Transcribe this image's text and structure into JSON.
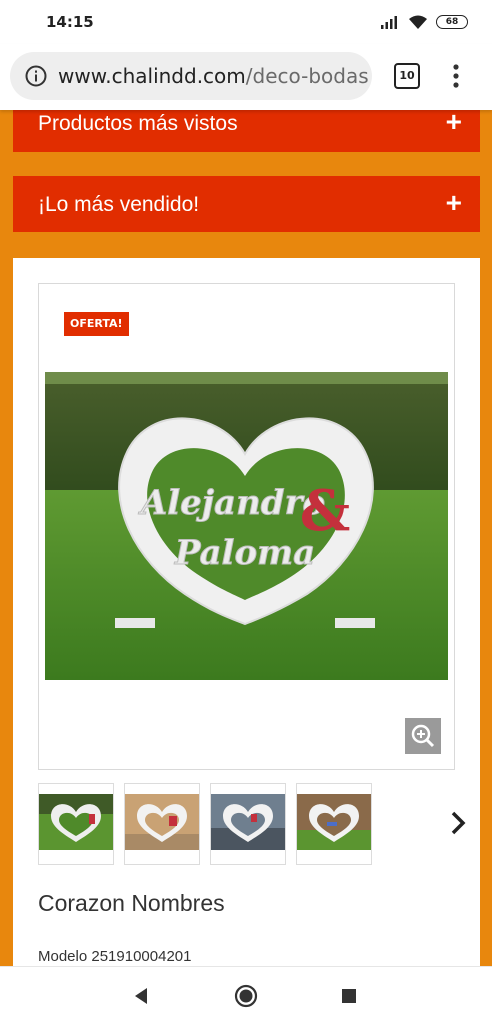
{
  "status_bar": {
    "time": "14:15",
    "battery_level": "68"
  },
  "browser": {
    "url_domain": "www.chalindd.com",
    "url_path": "/deco-bodas/",
    "tab_count": "10",
    "icons": [
      "info-icon",
      "more-vert-icon"
    ]
  },
  "accordions": [
    {
      "label": "Productos más vistos",
      "icon": "plus-icon"
    },
    {
      "label": "¡Lo más vendido!",
      "icon": "plus-icon"
    }
  ],
  "product": {
    "badge": "OFERTA!",
    "image_text": {
      "name1": "Alejandro",
      "ampersand": "&",
      "name2": "Paloma"
    },
    "thumbnail_count": 4,
    "name": "Corazon Nombres",
    "model": "Modelo 251910004201"
  },
  "colors": {
    "page_orange": "#e8870d",
    "bar_red": "#e12d00",
    "badge_red": "#e12d00",
    "zoom_gray": "#9a9a9a"
  },
  "system_nav": {
    "icons": [
      "back-icon",
      "home-icon",
      "recents-icon"
    ]
  }
}
